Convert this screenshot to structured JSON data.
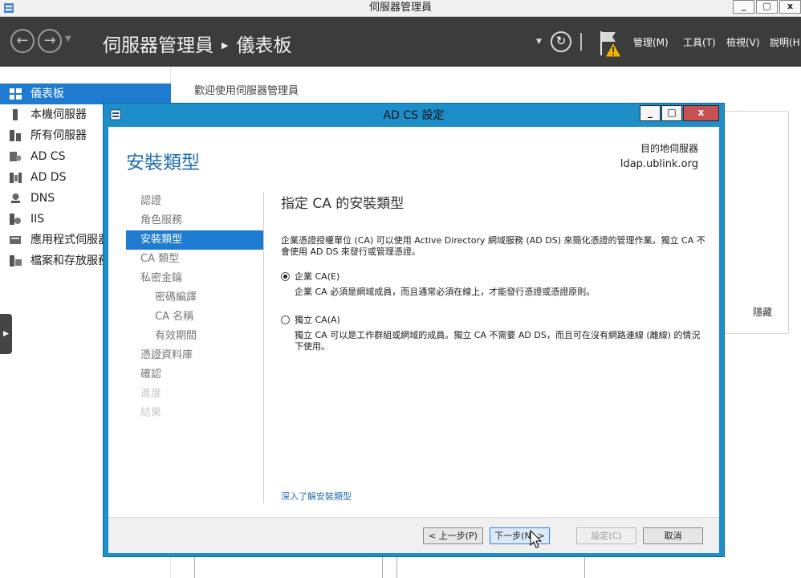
{
  "window": {
    "title": "伺服器管理員",
    "min": "_",
    "restore": "▢",
    "close": "x"
  },
  "header": {
    "breadcrumb_root": "伺服器管理員",
    "breadcrumb_sep": "▶",
    "breadcrumb_page": "儀表板",
    "menus": [
      "管理(M)",
      "工具(T)",
      "檢視(V)",
      "說明(H)"
    ]
  },
  "sidebar": {
    "items": [
      {
        "label": "儀表板",
        "icon": "dashboard-icon",
        "active": true
      },
      {
        "label": "本機伺服器",
        "icon": "server-icon"
      },
      {
        "label": "所有伺服器",
        "icon": "servers-icon"
      },
      {
        "label": "AD CS",
        "icon": "adcs-icon"
      },
      {
        "label": "AD DS",
        "icon": "adds-icon"
      },
      {
        "label": "DNS",
        "icon": "dns-icon"
      },
      {
        "label": "IIS",
        "icon": "iis-icon"
      },
      {
        "label": "應用程式伺服器",
        "icon": "app-server-icon"
      },
      {
        "label": "檔案和存放服務",
        "icon": "file-storage-icon"
      }
    ]
  },
  "main": {
    "welcome": "歡迎使用伺服器管理員",
    "hide": "隱藏"
  },
  "dialog": {
    "title": "AD CS 設定",
    "heading": "安裝類型",
    "dest_label": "目的地伺服器",
    "dest_host": "ldap.ublink.org",
    "steps": [
      {
        "label": "認證",
        "state": "normal"
      },
      {
        "label": "角色服務",
        "state": "normal"
      },
      {
        "label": "安裝類型",
        "state": "active"
      },
      {
        "label": "CA 類型",
        "state": "normal"
      },
      {
        "label": "私密金鑰",
        "state": "normal"
      },
      {
        "label": "密碼編譯",
        "state": "sub"
      },
      {
        "label": "CA 名稱",
        "state": "sub"
      },
      {
        "label": "有效期間",
        "state": "sub"
      },
      {
        "label": "憑證資料庫",
        "state": "normal"
      },
      {
        "label": "確認",
        "state": "normal"
      },
      {
        "label": "進度",
        "state": "disabled"
      },
      {
        "label": "結果",
        "state": "disabled"
      }
    ],
    "content_title": "指定 CA 的安裝類型",
    "content_desc": "企業憑證授權單位 (CA) 可以使用 Active Directory 網域服務 (AD DS) 來簡化憑證的管理作業。獨立 CA 不會使用 AD DS 來發行或管理憑證。",
    "options": [
      {
        "label": "企業 CA(E)",
        "desc": "企業 CA 必須是網域成員，而且通常必須在線上，才能發行憑證或憑證原則。",
        "selected": true
      },
      {
        "label": "獨立 CA(A)",
        "desc": "獨立 CA 可以是工作群組或網域的成員。獨立 CA 不需要 AD DS，而且可在沒有網路連線 (離線) 的情況下使用。",
        "selected": false
      }
    ],
    "learn_more": "深入了解安裝類型",
    "buttons": {
      "prev": "< 上一步(P)",
      "next": "下一步(N) >",
      "configure": "設定(C)",
      "cancel": "取消"
    }
  },
  "colors": {
    "accent": "#1f7bd0",
    "header_bg": "#3c3c3c",
    "dialog_frame": "#1e8ec9"
  }
}
